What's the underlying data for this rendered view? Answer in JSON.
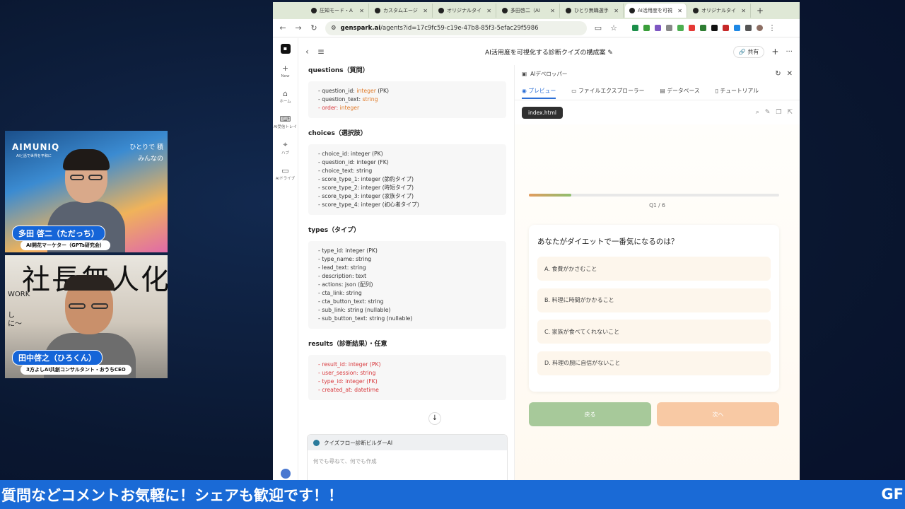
{
  "browser": {
    "tabs": [
      {
        "label": "圧知モード・A",
        "active": false
      },
      {
        "label": "カスタムエージ",
        "active": false
      },
      {
        "label": "オリジナルタイ",
        "active": false
      },
      {
        "label": "多田啓二（AI",
        "active": false
      },
      {
        "label": "ひとり無職選手",
        "active": false
      },
      {
        "label": "AI活用度を可視",
        "active": true
      },
      {
        "label": "オリジナルタイ",
        "active": false
      }
    ],
    "url_domain": "genspark.ai",
    "url_path": "/agents?id=17c9fc59-c19e-47b8-85f3-5efac29f5986"
  },
  "rail": {
    "items": [
      {
        "icon": "+",
        "label": "New"
      },
      {
        "icon": "⌂",
        "label": "ホーム"
      },
      {
        "icon": "⌨",
        "label": "AI受信トレイ"
      },
      {
        "icon": "⌖",
        "label": "ハブ"
      },
      {
        "icon": "▭",
        "label": "AIドライブ"
      }
    ]
  },
  "topbar": {
    "title": "AI活用度を可視化する診断クイズの構成案 ✎",
    "share_label": "共有"
  },
  "schema": {
    "questions": {
      "title": "questions（質問）",
      "lines": [
        {
          "name": "- question_id: ",
          "type": "integer",
          "note": " (PK)",
          "red": false
        },
        {
          "name": "- question_text: ",
          "type": "string",
          "note": "",
          "red": false
        },
        {
          "name": "- order: ",
          "type": "integer",
          "note": "",
          "red": true
        }
      ]
    },
    "choices": {
      "title": "choices（選択肢）",
      "lines": [
        "- choice_id: integer (PK)",
        "- question_id: integer (FK)",
        "- choice_text: string",
        "- score_type_1: integer (節約タイプ)",
        "- score_type_2: integer (時短タイプ)",
        "- score_type_3: integer (家族タイプ)",
        "- score_type_4: integer (初心者タイプ)"
      ]
    },
    "types": {
      "title": "types（タイプ）",
      "lines": [
        "- type_id: integer (PK)",
        "- type_name: string",
        "- lead_text: string",
        "- description: text",
        "- actions: json (配列)",
        "- cta_link: string",
        "- cta_button_text: string",
        "- sub_link: string (nullable)",
        "- sub_button_text: string (nullable)"
      ]
    },
    "results": {
      "title": "results（診断結果）・任意",
      "lines": [
        "- result_id: integer (PK)",
        "- user_session: string",
        "- type_id: integer (FK)",
        "- created_at: datetime"
      ]
    }
  },
  "composer": {
    "agent_name": "クイズフロー診断ビルダーAI",
    "placeholder": "何でも尋ねて、何でも作成"
  },
  "dev": {
    "title": "AIデベロッパー",
    "tabs": [
      "プレビュー",
      "ファイルエクスプローラー",
      "データベース",
      "チュートリアル"
    ],
    "file": "index.html"
  },
  "quiz": {
    "progress": 0.17,
    "count_label": "Q1 / 6",
    "question": "あなたがダイエットで一番気になるのは？",
    "options": [
      "A. 食費がかさむこと",
      "B. 料理に時間がかかること",
      "C. 家族が食べてくれないこと",
      "D. 料理の腕に自信がないこと"
    ],
    "back_label": "戻る",
    "next_label": "次へ"
  },
  "cams": {
    "cam1": {
      "brand": "AIMUNIQ",
      "brand_sub": "AIと話で世界を平和に",
      "slogan_1": "ひとりで 積",
      "slogan_2": "みんなの",
      "name": "多田 啓二（ただっち）",
      "role": "AI開花マーケター（GPTs研究会）"
    },
    "cam2": {
      "bigtext": "社長無人化",
      "side_1": "WORK",
      "side_2": "し",
      "side_3": "に～",
      "name": "田中啓之（ひろくん）",
      "role": "3方よしAI共創コンサルタント・おうちCEO"
    }
  },
  "banner": {
    "text": "質問などコメントお気軽に！シェアも歓迎です！！",
    "tail": "GF"
  },
  "colors": {
    "banner": "#1a6ad6",
    "accent": "#2c6fd6",
    "back_button": "#a7c99a",
    "next_button": "#f8c9a4"
  }
}
